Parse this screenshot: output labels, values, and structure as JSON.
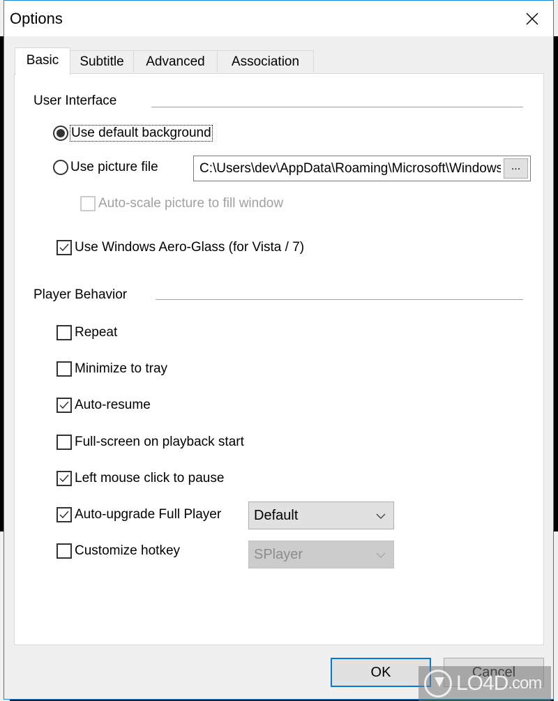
{
  "window": {
    "title": "Options",
    "close_icon": "close-icon"
  },
  "tabs": [
    {
      "label": "Basic",
      "active": true
    },
    {
      "label": "Subtitle",
      "active": false
    },
    {
      "label": "Advanced",
      "active": false
    },
    {
      "label": "Association",
      "active": false
    }
  ],
  "user_interface": {
    "heading": "User Interface",
    "use_default_background": {
      "label": "Use default background",
      "selected": true
    },
    "use_picture_file": {
      "label": "Use picture file",
      "selected": false
    },
    "picture_path": "C:\\Users\\dev\\AppData\\Roaming\\Microsoft\\Windows",
    "browse_label": "...",
    "auto_scale": {
      "label": "Auto-scale picture to fill window",
      "checked": false,
      "disabled": true
    },
    "aero_glass": {
      "label": "Use Windows Aero-Glass (for Vista / 7)",
      "checked": true
    }
  },
  "player_behavior": {
    "heading": "Player Behavior",
    "options": [
      {
        "label": "Repeat",
        "checked": false
      },
      {
        "label": "Minimize to tray",
        "checked": false
      },
      {
        "label": "Auto-resume",
        "checked": true
      },
      {
        "label": "Full-screen on playback start",
        "checked": false
      },
      {
        "label": "Left mouse click to pause",
        "checked": true
      },
      {
        "label": "Auto-upgrade Full Player",
        "checked": true
      },
      {
        "label": "Customize hotkey",
        "checked": false
      }
    ],
    "upgrade_combo": {
      "value": "Default",
      "disabled": false
    },
    "hotkey_combo": {
      "value": "SPlayer",
      "disabled": true
    }
  },
  "buttons": {
    "ok": "OK",
    "cancel": "Cancel"
  },
  "watermark": {
    "brand": "LO4D",
    "suffix": ".com"
  },
  "colors": {
    "accent": "#0078d7",
    "window_border": "#1883d7"
  }
}
